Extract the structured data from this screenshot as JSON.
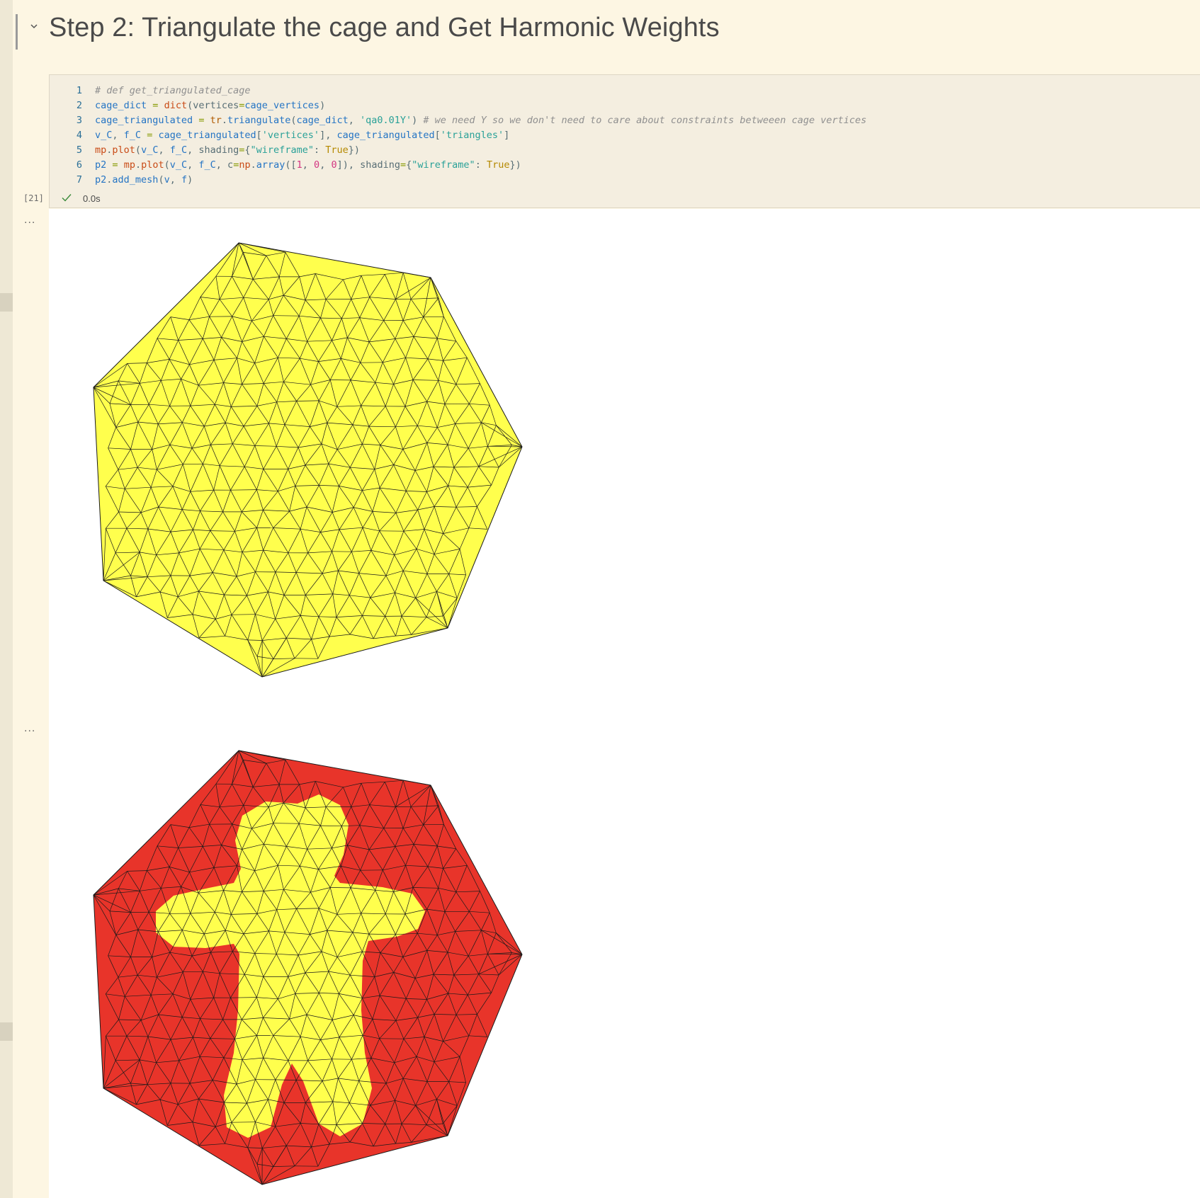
{
  "heading": {
    "title": "Step 2: Triangulate the cage and Get Harmonic Weights"
  },
  "cell": {
    "execution_count": "[21]",
    "exec_time": "0.0s",
    "lines": [
      {
        "no": "1",
        "tokens": [
          [
            "cm",
            "# def get_triangulated_cage"
          ]
        ]
      },
      {
        "no": "2",
        "tokens": [
          [
            "var",
            "cage_dict"
          ],
          [
            "pl",
            " "
          ],
          [
            "op",
            "="
          ],
          [
            "pl",
            " "
          ],
          [
            "fn2",
            "dict"
          ],
          [
            "pl",
            "(vertices"
          ],
          [
            "op",
            "="
          ],
          [
            "var",
            "cage_vertices"
          ],
          [
            "pl",
            ")"
          ]
        ]
      },
      {
        "no": "3",
        "tokens": [
          [
            "var",
            "cage_triangulated"
          ],
          [
            "pl",
            " "
          ],
          [
            "op",
            "="
          ],
          [
            "pl",
            " "
          ],
          [
            "fn",
            "tr"
          ],
          [
            "pl",
            "."
          ],
          [
            "var",
            "triangulate"
          ],
          [
            "pl",
            "("
          ],
          [
            "var",
            "cage_dict"
          ],
          [
            "pl",
            ", "
          ],
          [
            "str",
            "'qa0.01Y'"
          ],
          [
            "pl",
            ") "
          ],
          [
            "cm",
            "# we need Y so we don't need to care about constraints betweeen cage vertices"
          ]
        ]
      },
      {
        "no": "4",
        "tokens": [
          [
            "var",
            "v_C"
          ],
          [
            "pl",
            ", "
          ],
          [
            "var",
            "f_C"
          ],
          [
            "pl",
            " "
          ],
          [
            "op",
            "="
          ],
          [
            "pl",
            " "
          ],
          [
            "var",
            "cage_triangulated"
          ],
          [
            "pl",
            "["
          ],
          [
            "str",
            "'vertices'"
          ],
          [
            "pl",
            "], "
          ],
          [
            "var",
            "cage_triangulated"
          ],
          [
            "pl",
            "["
          ],
          [
            "str",
            "'triangles'"
          ],
          [
            "pl",
            "]"
          ]
        ]
      },
      {
        "no": "5",
        "tokens": [
          [
            "fn2",
            "mp"
          ],
          [
            "pl",
            "."
          ],
          [
            "fn2",
            "plot"
          ],
          [
            "pl",
            "("
          ],
          [
            "var",
            "v_C"
          ],
          [
            "pl",
            ", "
          ],
          [
            "var",
            "f_C"
          ],
          [
            "pl",
            ", shading"
          ],
          [
            "op",
            "="
          ],
          [
            "pl",
            "{"
          ],
          [
            "str",
            "\"wireframe\""
          ],
          [
            "pl",
            ": "
          ],
          [
            "kw",
            "True"
          ],
          [
            "pl",
            "})"
          ]
        ]
      },
      {
        "no": "6",
        "tokens": [
          [
            "var",
            "p2"
          ],
          [
            "pl",
            " "
          ],
          [
            "op",
            "="
          ],
          [
            "pl",
            " "
          ],
          [
            "fn2",
            "mp"
          ],
          [
            "pl",
            "."
          ],
          [
            "fn2",
            "plot"
          ],
          [
            "pl",
            "("
          ],
          [
            "var",
            "v_C"
          ],
          [
            "pl",
            ", "
          ],
          [
            "var",
            "f_C"
          ],
          [
            "pl",
            ", c"
          ],
          [
            "op",
            "="
          ],
          [
            "fn2",
            "np"
          ],
          [
            "pl",
            "."
          ],
          [
            "var",
            "array"
          ],
          [
            "pl",
            "(["
          ],
          [
            "num",
            "1"
          ],
          [
            "pl",
            ", "
          ],
          [
            "num",
            "0"
          ],
          [
            "pl",
            ", "
          ],
          [
            "num",
            "0"
          ],
          [
            "pl",
            "]), shading"
          ],
          [
            "op",
            "="
          ],
          [
            "pl",
            "{"
          ],
          [
            "str",
            "\"wireframe\""
          ],
          [
            "pl",
            ": "
          ],
          [
            "kw",
            "True"
          ],
          [
            "pl",
            "})"
          ]
        ]
      },
      {
        "no": "7",
        "tokens": [
          [
            "var",
            "p2"
          ],
          [
            "pl",
            "."
          ],
          [
            "var",
            "add_mesh"
          ],
          [
            "pl",
            "("
          ],
          [
            "var",
            "v"
          ],
          [
            "pl",
            ", "
          ],
          [
            "var",
            "f"
          ],
          [
            "pl",
            ")"
          ]
        ]
      }
    ]
  },
  "outputs": [
    {
      "ellipsis": "...",
      "cage_fill": "#ffff4d",
      "figure_fill": null
    },
    {
      "ellipsis": "...",
      "cage_fill": "#e8342a",
      "figure_fill": "#ffff4d"
    }
  ],
  "colors": {
    "mesh_line": "#1a1a1a",
    "cage_yellow": "#ffff4d",
    "cage_red": "#e8342a"
  },
  "icons": {
    "collapse": "chevron-down-icon",
    "status": "check-icon",
    "more": "ellipsis-icon"
  }
}
